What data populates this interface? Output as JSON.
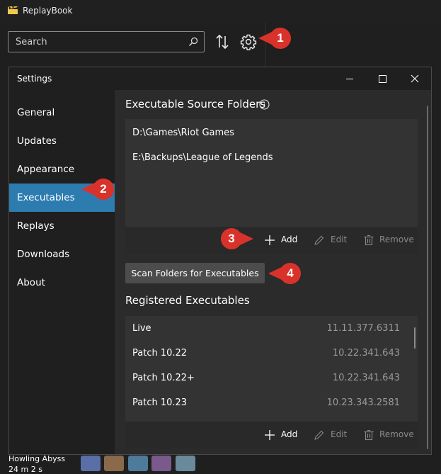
{
  "app": {
    "title": "ReplayBook",
    "search_placeholder": "Search",
    "list_item": {
      "title": "Howling Abyss",
      "duration": "24 m 2 s"
    }
  },
  "settings": {
    "title": "Settings",
    "nav": [
      {
        "label": "General",
        "selected": false
      },
      {
        "label": "Updates",
        "selected": false
      },
      {
        "label": "Appearance",
        "selected": false
      },
      {
        "label": "Executables",
        "selected": true
      },
      {
        "label": "Replays",
        "selected": false
      },
      {
        "label": "Downloads",
        "selected": false
      },
      {
        "label": "About",
        "selected": false
      }
    ],
    "source_folders": {
      "title": "Executable Source Folders",
      "items": [
        "D:\\Games\\Riot Games",
        "E:\\Backups\\League of Legends"
      ],
      "toolbar": {
        "add": "Add",
        "edit": "Edit",
        "remove": "Remove"
      }
    },
    "scan_button": "Scan Folders for Executables",
    "registered": {
      "title": "Registered Executables",
      "items": [
        {
          "name": "Live",
          "version": "11.11.377.6311"
        },
        {
          "name": "Patch 10.22",
          "version": "10.22.341.643"
        },
        {
          "name": "Patch 10.22+",
          "version": "10.22.341.643"
        },
        {
          "name": "Patch 10.23",
          "version": "10.23.343.2581"
        }
      ],
      "toolbar": {
        "add": "Add",
        "edit": "Edit",
        "remove": "Remove"
      }
    }
  },
  "callouts": [
    "1",
    "2",
    "3",
    "4"
  ],
  "colors": {
    "accent": "#2d7cb0",
    "callout": "#d9322a",
    "background": "#1f1f1f",
    "panel": "#333333"
  },
  "icons": [
    "search-icon",
    "sort-icon",
    "gear-icon",
    "info-icon",
    "plus-icon",
    "pencil-icon",
    "trash-icon",
    "minimize-icon",
    "maximize-icon",
    "close-icon"
  ]
}
